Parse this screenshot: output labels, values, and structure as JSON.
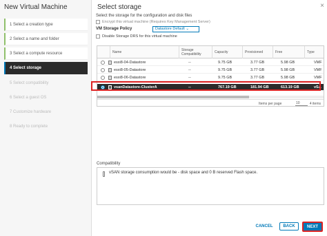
{
  "wizard": {
    "title": "New Virtual Machine",
    "steps": [
      {
        "label": "1  Select a creation type",
        "state": "done"
      },
      {
        "label": "2  Select a name and folder",
        "state": "done"
      },
      {
        "label": "3  Select a compute resource",
        "state": "done"
      },
      {
        "label": "4  Select storage",
        "state": "active"
      },
      {
        "label": "5  Select compatibility",
        "state": "future"
      },
      {
        "label": "6  Select a guest OS",
        "state": "future"
      },
      {
        "label": "7  Customize hardware",
        "state": "future"
      },
      {
        "label": "8  Ready to complete",
        "state": "future"
      }
    ]
  },
  "main": {
    "title": "Select storage",
    "instruction": "Select the storage for the configuration and disk files",
    "encrypt_label": "Encrypt this virtual machine (Requires Key Management Server)",
    "policy_label": "VM Storage Policy",
    "policy_value": "Datastore Default",
    "policy_chevron": "⌄",
    "disable_drs_label": "Disable Storage DRS for this virtual machine",
    "close_glyph": "×"
  },
  "table": {
    "columns": [
      "Name",
      "Storage Compatibility",
      "Capacity",
      "Provisioned",
      "Free",
      "Type"
    ],
    "rows": [
      {
        "name": "esxi8-04-Datastore",
        "compat": "--",
        "capacity": "9.75 GB",
        "provisioned": "3.77 GB",
        "free": "5.98 GB",
        "type": "VMF"
      },
      {
        "name": "esxi8-05-Datastore",
        "compat": "--",
        "capacity": "9.75 GB",
        "provisioned": "3.77 GB",
        "free": "5.98 GB",
        "type": "VMF"
      },
      {
        "name": "esxi8-06-Datastore",
        "compat": "--",
        "capacity": "9.75 GB",
        "provisioned": "3.77 GB",
        "free": "5.98 GB",
        "type": "VMF"
      },
      {
        "name": "vsanDatastore-ClusterA",
        "compat": "--",
        "capacity": "767.19 GB",
        "provisioned": "181.94 GB",
        "free": "613.19 GB",
        "type": "vSA"
      }
    ],
    "selected_index": 3,
    "per_page_label": "Items per page",
    "per_page_value": "10",
    "items_count": "4 items"
  },
  "compatibility": {
    "label": "Compatibility",
    "message": "vSAN storage consumption would be - disk space and 0 B reserved Flash space."
  },
  "buttons": {
    "cancel": "CANCEL",
    "back": "BACK",
    "next": "NEXT"
  },
  "colors": {
    "accent": "#0079b8",
    "highlight_border": "#dd2222",
    "selected_row": "#2b2b2b"
  }
}
